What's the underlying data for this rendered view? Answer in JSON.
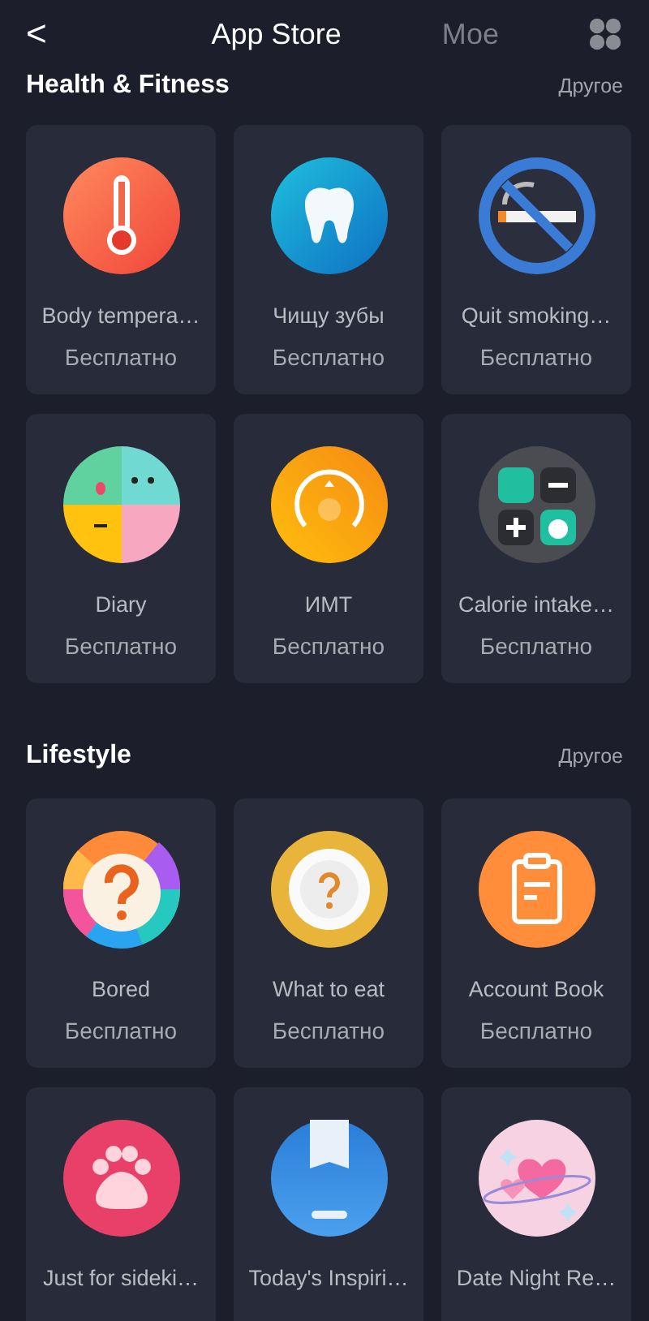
{
  "header": {
    "back": "<",
    "tabs": [
      {
        "label": "App Store",
        "selected": true
      },
      {
        "label": "Мое",
        "selected": false
      }
    ]
  },
  "sections": [
    {
      "title": "Health & Fitness",
      "more": "Другое",
      "apps": [
        {
          "name": "Body tempera…",
          "price": "Бесплатно"
        },
        {
          "name": "Чищу зубы",
          "price": "Бесплатно"
        },
        {
          "name": "Quit smoking…",
          "price": "Бесплатно"
        },
        {
          "name": "Diary",
          "price": "Бесплатно"
        },
        {
          "name": "ИМТ",
          "price": "Бесплатно"
        },
        {
          "name": "Calorie intake…",
          "price": "Бесплатно"
        }
      ]
    },
    {
      "title": "Lifestyle",
      "more": "Другое",
      "apps": [
        {
          "name": "Bored",
          "price": "Бесплатно"
        },
        {
          "name": "What to eat",
          "price": "Бесплатно"
        },
        {
          "name": "Account Book",
          "price": "Бесплатно"
        },
        {
          "name": "Just for sideki…"
        },
        {
          "name": "Today's Inspiri…"
        },
        {
          "name": "Date Night Re…"
        }
      ]
    }
  ]
}
